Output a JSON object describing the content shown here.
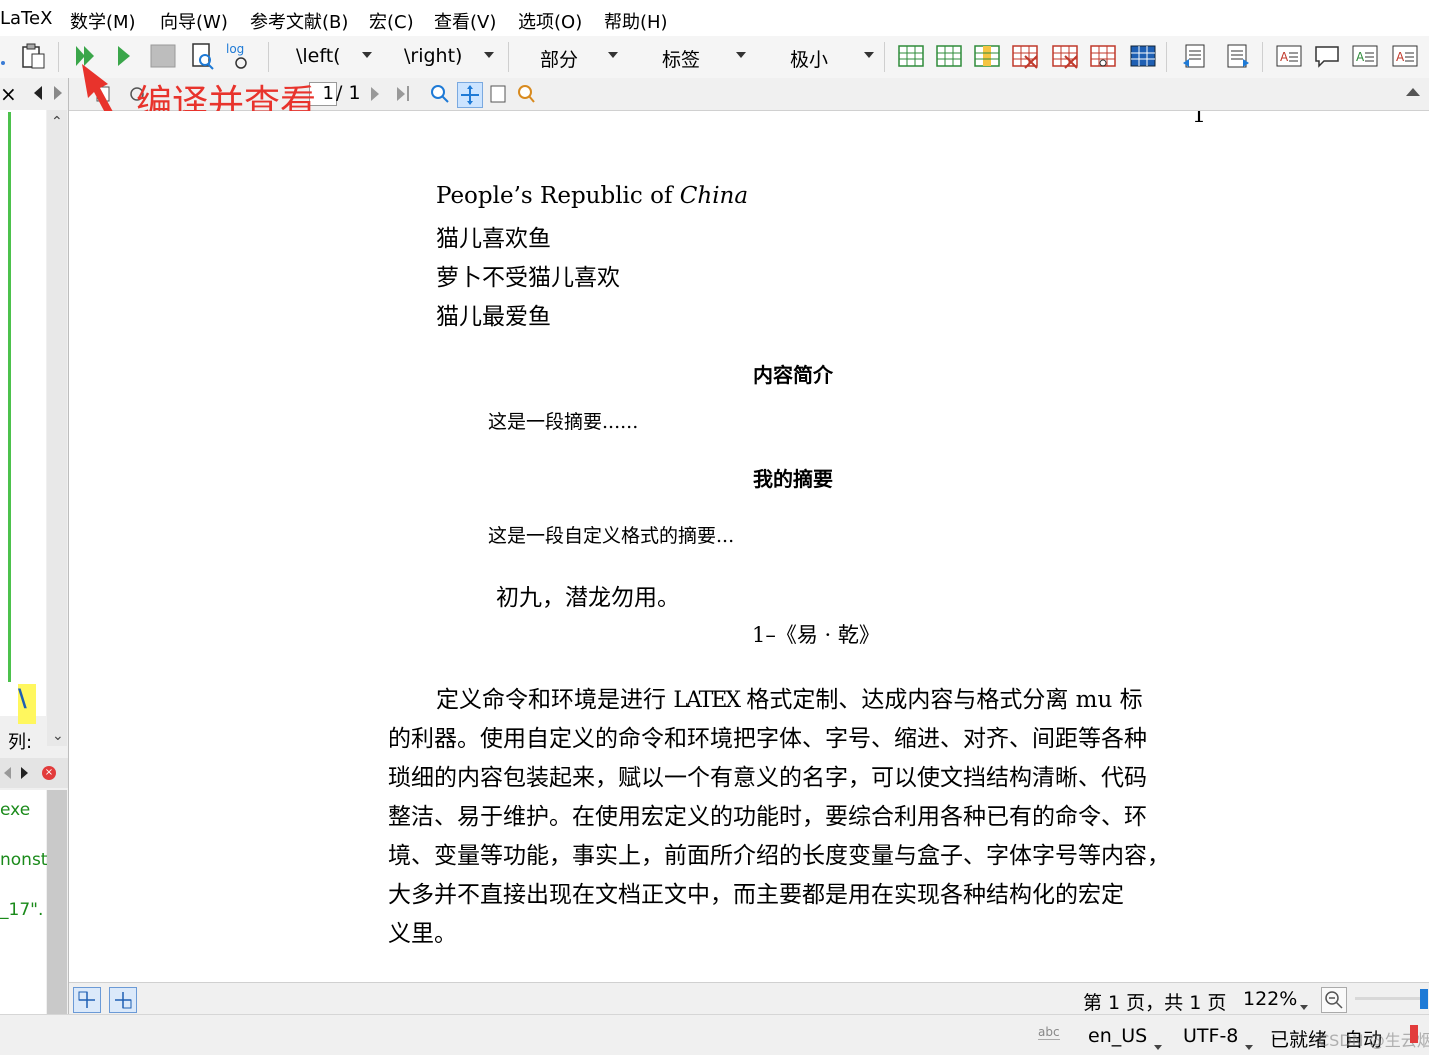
{
  "menu": [
    "LaTeX",
    "数学(M)",
    "向导(W)",
    "参考文献(B)",
    "宏(C)",
    "查看(V)",
    "选项(O)",
    "帮助(H)"
  ],
  "toolbar": {
    "log_label": "log",
    "combos": [
      "\\left(",
      "\\right)",
      "部分",
      "标签",
      "极小"
    ]
  },
  "annotation": {
    "text": "编译并查看",
    "color": "#e8332c"
  },
  "viewer": {
    "page_current": "1",
    "page_total": "/ 1"
  },
  "left_pane": {
    "backslash": "\\",
    "col_label": "列:",
    "log_lines": [
      "exe",
      "nonst",
      "_17\"."
    ]
  },
  "document": {
    "page_number": "1",
    "title_line_plain": "People’s Republic of ",
    "title_line_italic": "China",
    "poem_lines": [
      "猫儿喜欢鱼",
      "萝卜不受猫儿喜欢",
      "猫儿最爱鱼"
    ],
    "abstract1_title": "内容简介",
    "abstract1_text": "这是一段摘要......",
    "abstract2_title": "我的摘要",
    "abstract2_text": "这是一段自定义格式的摘要...",
    "quote_text": "初九，潜龙勿用。",
    "quote_source": "1–《易 · 乾》",
    "para_first_a": "定义命令和环境是进行 ",
    "para_first_b": " 格式定制、达成内容与格式分离 mu 标",
    "latex_logo": "LATEX",
    "para_lines": [
      "的利器。使用自定义的命令和环境把字体、字号、缩进、对齐、间距等各种",
      "琐细的内容包装起来，赋以一个有意义的名字，可以使文挡结构清晰、代码",
      "整洁、易于维护。在使用宏定义的功能时，要综合利用各种已有的命令、环",
      "境、变量等功能，事实上，前面所介绍的长度变量与盒子、字体字号等内容，",
      "大多并不直接出现在文档正文中，而主要都是用在实现各种结构化的宏定",
      "义里。"
    ]
  },
  "view_status": {
    "page_info": "第 1 页，共 1 页",
    "zoom": "122%"
  },
  "status": {
    "spell_icon_text": "abc",
    "language": "en_US",
    "encoding": "UTF-8",
    "ready": "已就绪",
    "mode": "自动",
    "watermark": "CSDN @生云烟"
  },
  "colors": {
    "compile_green": "#3aa64a",
    "accent_blue": "#1e7ad6"
  }
}
